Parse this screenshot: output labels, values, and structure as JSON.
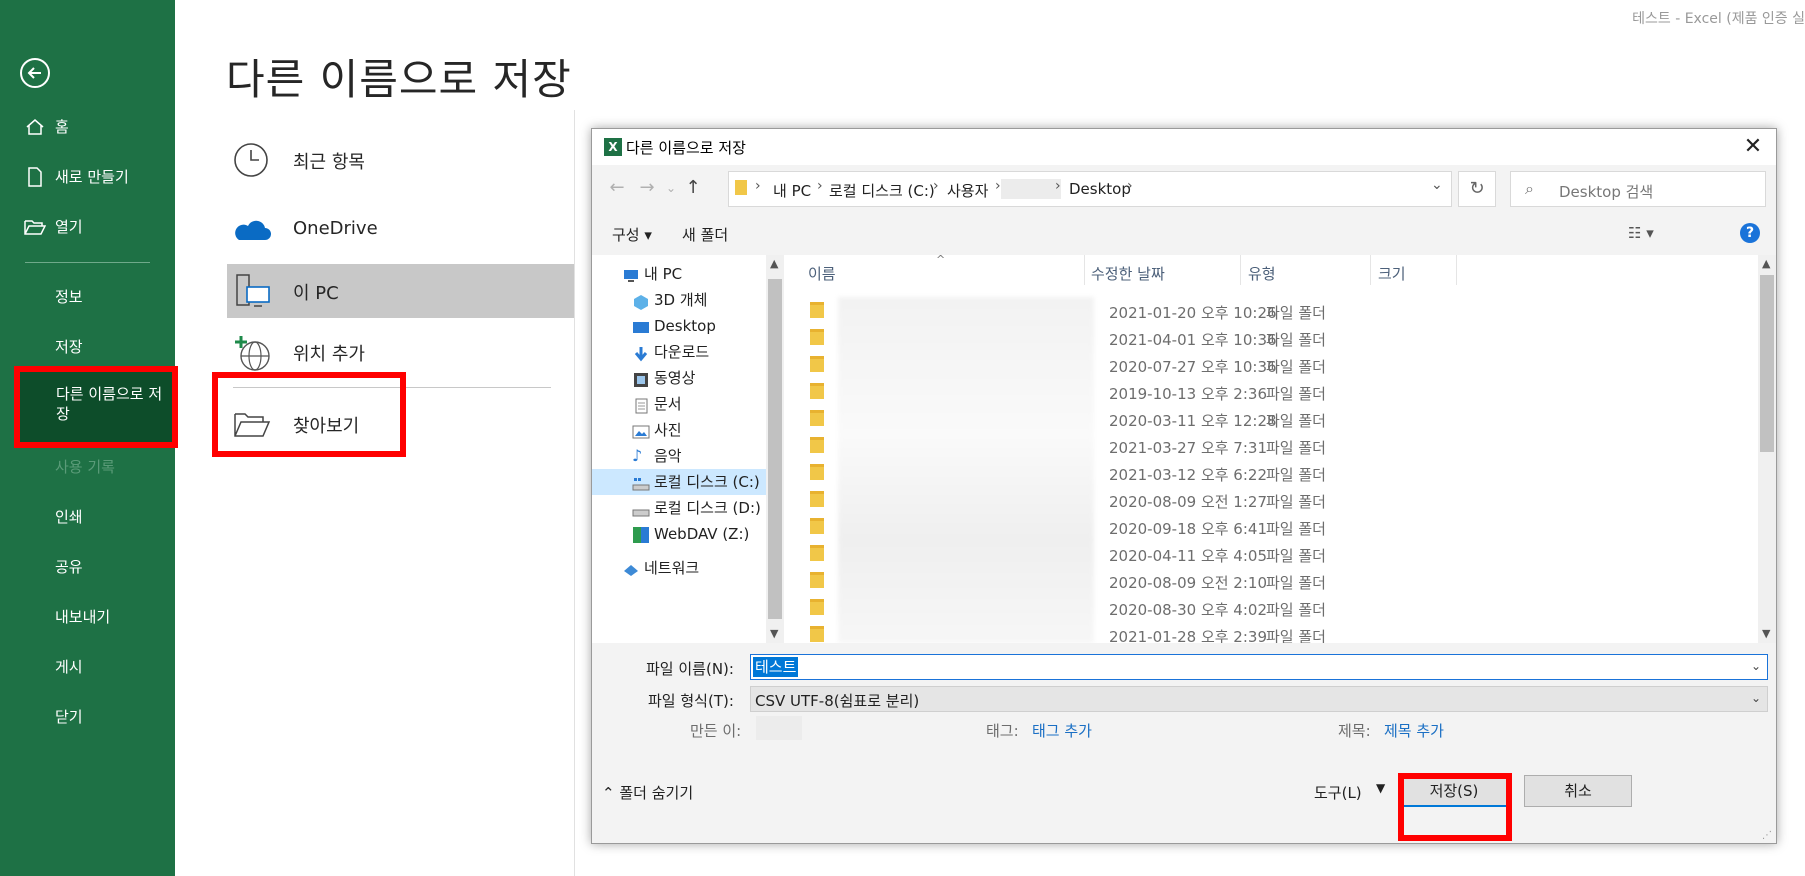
{
  "window_title": "테스트  -  Excel (제품 인증 실",
  "nav": {
    "items": [
      {
        "label": "홈",
        "icon": "home-icon"
      },
      {
        "label": "새로 만들기",
        "icon": "new-doc-icon"
      },
      {
        "label": "열기",
        "icon": "open-folder-icon"
      },
      {
        "label": "정보"
      },
      {
        "label": "저장"
      },
      {
        "label": "다른 이름으로 저장"
      },
      {
        "label": "사용 기록"
      },
      {
        "label": "인쇄"
      },
      {
        "label": "공유"
      },
      {
        "label": "내보내기"
      },
      {
        "label": "게시"
      },
      {
        "label": "닫기"
      }
    ]
  },
  "backstage": {
    "title": "다른 이름으로 저장",
    "locations": [
      {
        "label": "최근 항목",
        "icon": "clock-icon"
      },
      {
        "label": "OneDrive",
        "icon": "onedrive-cloud-icon"
      },
      {
        "label": "이 PC",
        "icon": "this-pc-icon"
      },
      {
        "label": "위치 추가",
        "icon": "add-location-globe-icon"
      },
      {
        "label": "찾아보기",
        "icon": "browse-folder-icon"
      }
    ]
  },
  "dialog": {
    "title": "다른 이름으로 저장",
    "breadcrumb": [
      "내 PC",
      "로컬 디스크 (C:)",
      "사용자",
      "Desktop"
    ],
    "search_placeholder": "Desktop 검색",
    "toolbar": {
      "organize": "구성",
      "new_folder": "새 폴더",
      "help": "?"
    },
    "tree": [
      {
        "label": "내 PC",
        "icon": "pc-icon"
      },
      {
        "label": "3D 개체",
        "icon": "3d-objects-icon"
      },
      {
        "label": "Desktop",
        "icon": "desktop-icon"
      },
      {
        "label": "다운로드",
        "icon": "download-icon"
      },
      {
        "label": "동영상",
        "icon": "video-icon"
      },
      {
        "label": "문서",
        "icon": "document-icon"
      },
      {
        "label": "사진",
        "icon": "picture-icon"
      },
      {
        "label": "음악",
        "icon": "music-icon"
      },
      {
        "label": "로컬 디스크 (C:)",
        "icon": "drive-c-icon",
        "selected": true
      },
      {
        "label": "로컬 디스크 (D:)",
        "icon": "drive-d-icon"
      },
      {
        "label": "WebDAV (Z:)",
        "icon": "network-drive-icon"
      },
      {
        "label": "네트워크",
        "icon": "network-icon"
      }
    ],
    "columns": {
      "name": "이름",
      "modified": "수정한 날짜",
      "type": "유형",
      "size": "크기"
    },
    "files": [
      {
        "date": "2021-01-20 오후 10:26",
        "type": "파일 폴더"
      },
      {
        "date": "2021-04-01 오후 10:36",
        "type": "파일 폴더"
      },
      {
        "date": "2020-07-27 오후 10:36",
        "type": "파일 폴더"
      },
      {
        "date": "2019-10-13 오후 2:36",
        "type": "파일 폴더"
      },
      {
        "date": "2020-03-11 오후 12:28",
        "type": "파일 폴더"
      },
      {
        "date": "2021-03-27 오후 7:31",
        "type": "파일 폴더"
      },
      {
        "date": "2021-03-12 오후 6:22",
        "type": "파일 폴더"
      },
      {
        "date": "2020-08-09 오전 1:27",
        "type": "파일 폴더"
      },
      {
        "date": "2020-09-18 오후 6:41",
        "type": "파일 폴더"
      },
      {
        "date": "2020-04-11 오후 4:05",
        "type": "파일 폴더"
      },
      {
        "date": "2020-08-09 오전 2:10",
        "type": "파일 폴더"
      },
      {
        "date": "2020-08-30 오후 4:02",
        "type": "파일 폴더"
      },
      {
        "date": "2021-01-28 오후 2:39",
        "type": "파일 폴더"
      }
    ],
    "form": {
      "filename_label": "파일 이름(N):",
      "filename_value": "테스트",
      "filetype_label": "파일 형식(T):",
      "filetype_value": "CSV UTF-8(쉼표로 분리)",
      "author_label": "만든 이:",
      "tags_label": "태그:",
      "tags_value": "태그 추가",
      "title_label": "제목:",
      "title_value": "제목 추가"
    },
    "buttons": {
      "hide_folders": "폴더 숨기기",
      "tools": "도구(L)",
      "save": "저장(S)",
      "cancel": "취소"
    }
  }
}
